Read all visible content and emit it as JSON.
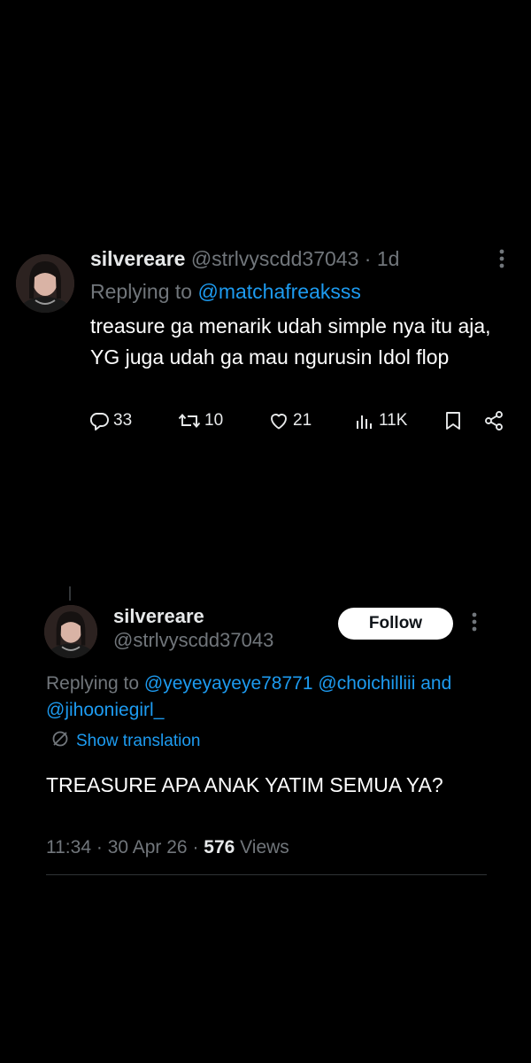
{
  "tweet1": {
    "display_name": "silvereare",
    "handle": "@strlvyscdd37043",
    "separator": "·",
    "time": "1d",
    "replying_prefix": "Replying to",
    "replying_to": "@matchafreaksss",
    "text": "treasure ga menarik udah simple nya itu aja, YG juga udah ga mau ngurusin Idol flop",
    "stats": {
      "replies": "33",
      "reposts": "10",
      "likes": "21",
      "views": "11K"
    }
  },
  "tweet2": {
    "display_name": "silvereare",
    "handle": "@strlvyscdd37043",
    "follow_label": "Follow",
    "replying_prefix": "Replying to",
    "replying_to_1": "@yeyeyayeye78771",
    "replying_to_2": "@choichilliii",
    "replying_and": "and",
    "replying_to_3": "@jihooniegirl_",
    "translate_label": "Show translation",
    "text": "TREASURE APA ANAK YATIM SEMUA YA?",
    "time": "11:34",
    "dot": "·",
    "date": "30 Apr 26",
    "views_count": "576",
    "views_label": "Views"
  },
  "icons": {
    "reply": "reply-icon",
    "repost": "repost-icon",
    "like": "heart-icon",
    "views": "views-chart-icon",
    "bookmark": "bookmark-icon",
    "share": "share-icon",
    "more": "more-vertical-icon",
    "translate": "translate-globe-icon"
  },
  "colors": {
    "background": "#000000",
    "text": "#e7e9ea",
    "muted": "#71767b",
    "link": "#1d9bf0",
    "follow_bg": "#ffffff"
  }
}
